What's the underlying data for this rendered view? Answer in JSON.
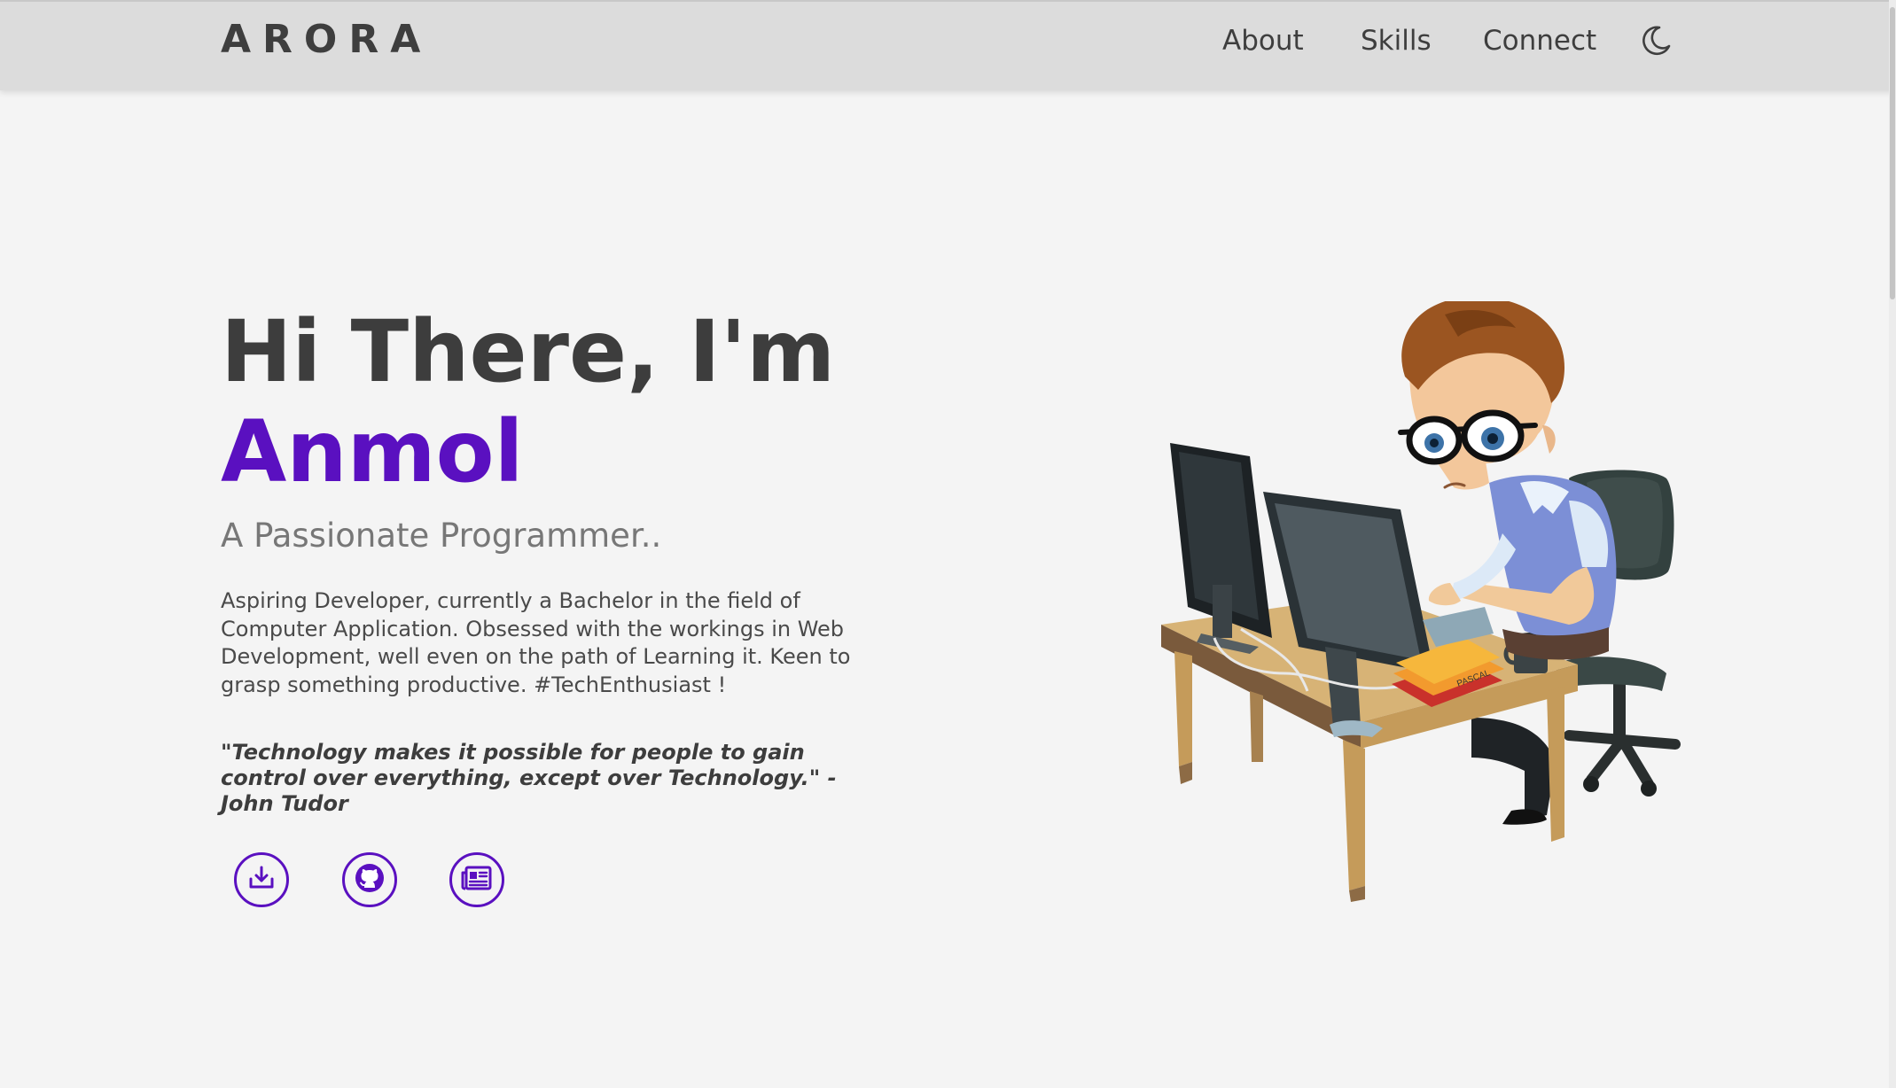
{
  "header": {
    "logo": "ARORA",
    "nav": {
      "about": "About",
      "skills": "Skills",
      "connect": "Connect"
    },
    "theme_toggle_icon": "moon-icon"
  },
  "hero": {
    "greeting": "Hi There, I'm",
    "name": "Anmol",
    "tagline": "A Passionate Programmer..",
    "bio": "Aspiring Developer, currently a Bachelor in the field of Computer Application. Obsessed with the workings in Web Development, well even on the path of Learning it. Keen to grasp something productive. #TechEnthusiast !",
    "quote": "\"Technology makes it possible for people to gain control over everything, except over Technology.\" - John Tudor",
    "book_label": "PASCAL"
  },
  "social_buttons": [
    {
      "icon": "download-icon"
    },
    {
      "icon": "github-icon"
    },
    {
      "icon": "newspaper-icon"
    }
  ],
  "colors": {
    "accent": "#5a10c0",
    "header_bg": "#dcdcdc",
    "page_bg": "#f4f4f4",
    "text_dark": "#3d3d3d",
    "text_muted": "#777777"
  }
}
